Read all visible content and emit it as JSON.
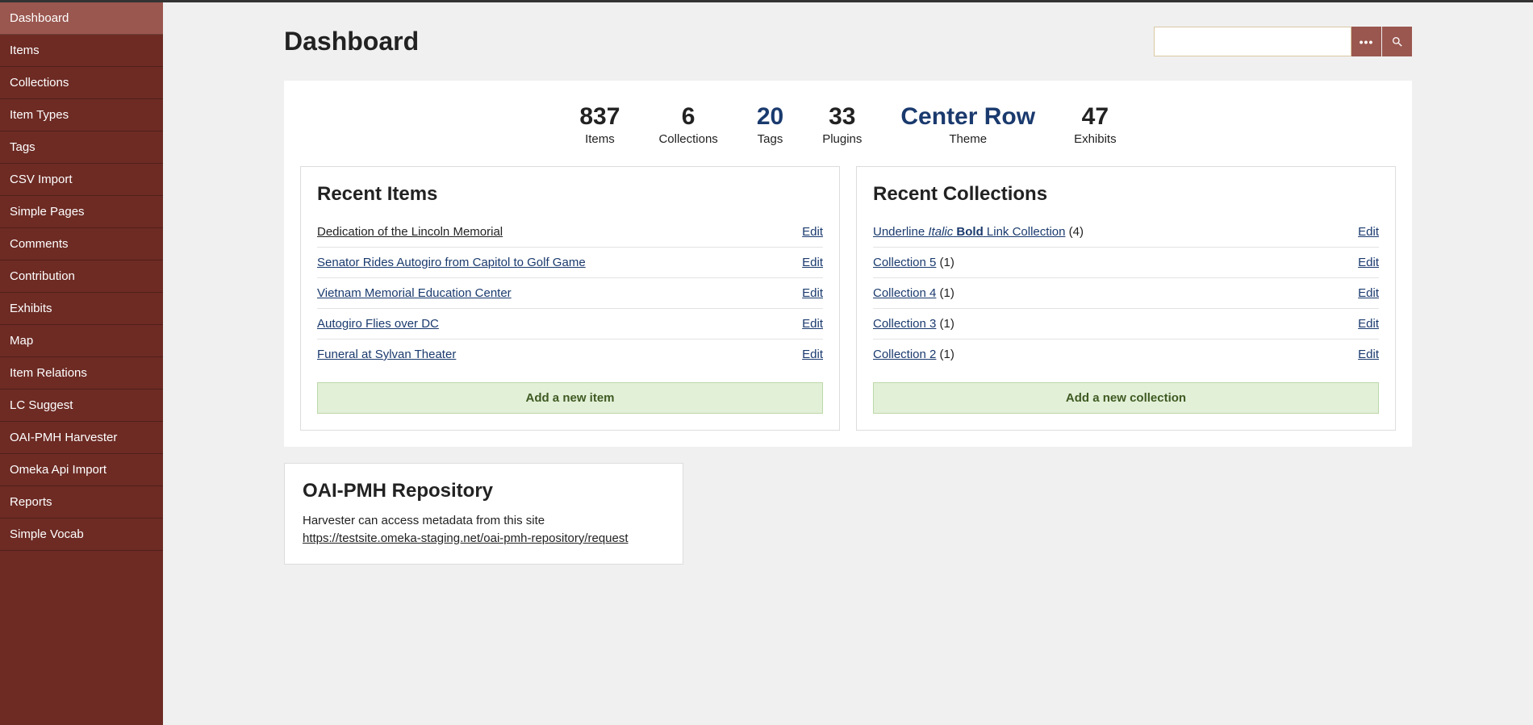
{
  "sidebar": {
    "items": [
      {
        "label": "Dashboard",
        "active": true
      },
      {
        "label": "Items"
      },
      {
        "label": "Collections"
      },
      {
        "label": "Item Types"
      },
      {
        "label": "Tags"
      },
      {
        "label": "CSV Import"
      },
      {
        "label": "Simple Pages"
      },
      {
        "label": "Comments"
      },
      {
        "label": "Contribution"
      },
      {
        "label": "Exhibits"
      },
      {
        "label": "Map"
      },
      {
        "label": "Item Relations"
      },
      {
        "label": "LC Suggest"
      },
      {
        "label": "OAI-PMH Harvester"
      },
      {
        "label": "Omeka Api Import"
      },
      {
        "label": "Reports"
      },
      {
        "label": "Simple Vocab"
      }
    ]
  },
  "header": {
    "title": "Dashboard"
  },
  "search": {
    "value": ""
  },
  "stats": [
    {
      "value": "837",
      "label": "Items",
      "link": false
    },
    {
      "value": "6",
      "label": "Collections",
      "link": false
    },
    {
      "value": "20",
      "label": "Tags",
      "link": true
    },
    {
      "value": "33",
      "label": "Plugins",
      "link": false
    },
    {
      "value": "Center Row",
      "label": "Theme",
      "link": true
    },
    {
      "value": "47",
      "label": "Exhibits",
      "link": false
    }
  ],
  "recent_items": {
    "title": "Recent Items",
    "rows": [
      {
        "title": "Dedication of the Lincoln Memorial",
        "style": "plain"
      },
      {
        "title": "Senator Rides Autogiro from Capitol to Golf Game"
      },
      {
        "title": "Vietnam Memorial Education Center"
      },
      {
        "title": "Autogiro Flies over DC"
      },
      {
        "title": "Funeral at Sylvan Theater"
      }
    ],
    "edit_label": "Edit",
    "add_label": "Add a new item"
  },
  "recent_collections": {
    "title": "Recent Collections",
    "rows": [
      {
        "html": "<span class='u'>Underline</span> <span class='i'>Italic</span> <span class='b'>Bold</span> <span>Link Collection</span>",
        "count": "(4)"
      },
      {
        "title": "Collection 5",
        "count": "(1)"
      },
      {
        "title": "Collection 4",
        "count": "(1)"
      },
      {
        "title": "Collection 3",
        "count": "(1)"
      },
      {
        "title": "Collection 2",
        "count": "(1)"
      }
    ],
    "edit_label": "Edit",
    "add_label": "Add a new collection"
  },
  "oai": {
    "title": "OAI-PMH Repository",
    "text_prefix": "Harvester can access metadata from this site ",
    "url": "https://testsite.omeka-staging.net/oai-pmh-repository/request"
  }
}
